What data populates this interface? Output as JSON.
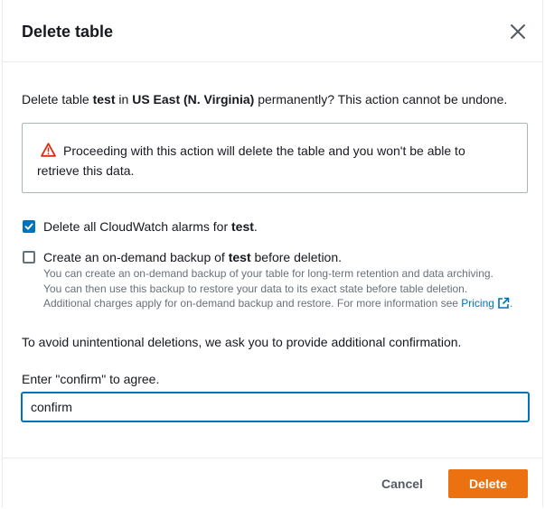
{
  "dialog": {
    "title": "Delete table",
    "close_icon": "close-icon"
  },
  "prompt": {
    "prefix": "Delete table ",
    "table_name": "test",
    "middle": " in ",
    "region": "US East (N. Virginia)",
    "suffix": " permanently? This action cannot be undone."
  },
  "warning": {
    "icon": "warning-icon",
    "text": "Proceeding with this action will delete the table and you won't be able to retrieve this data."
  },
  "options": {
    "alarms": {
      "checked": true,
      "label_prefix": "Delete all CloudWatch alarms for ",
      "table_name": "test",
      "label_suffix": "."
    },
    "backup": {
      "checked": false,
      "label_prefix": "Create an on-demand backup of ",
      "table_name": "test",
      "label_suffix": " before deletion.",
      "desc_line1": "You can create an on-demand backup of your table for long-term retention and data archiving.",
      "desc_line2": "You can then use this backup to restore your data to its exact state before table deletion.",
      "desc_line3": "Additional charges apply for on-demand backup and restore. For more information see ",
      "link_label": "Pricing",
      "link_icon": "external-link-icon",
      "desc_end": "."
    }
  },
  "confirmation": {
    "note": "To avoid unintentional deletions, we ask you to provide additional confirmation.",
    "input_label": "Enter \"confirm\" to agree.",
    "input_value": "confirm"
  },
  "footer": {
    "cancel_label": "Cancel",
    "delete_label": "Delete"
  },
  "colors": {
    "primary_button": "#ec7211",
    "checkbox_checked": "#0073bb",
    "link": "#0073bb",
    "warning_icon": "#d13212"
  }
}
